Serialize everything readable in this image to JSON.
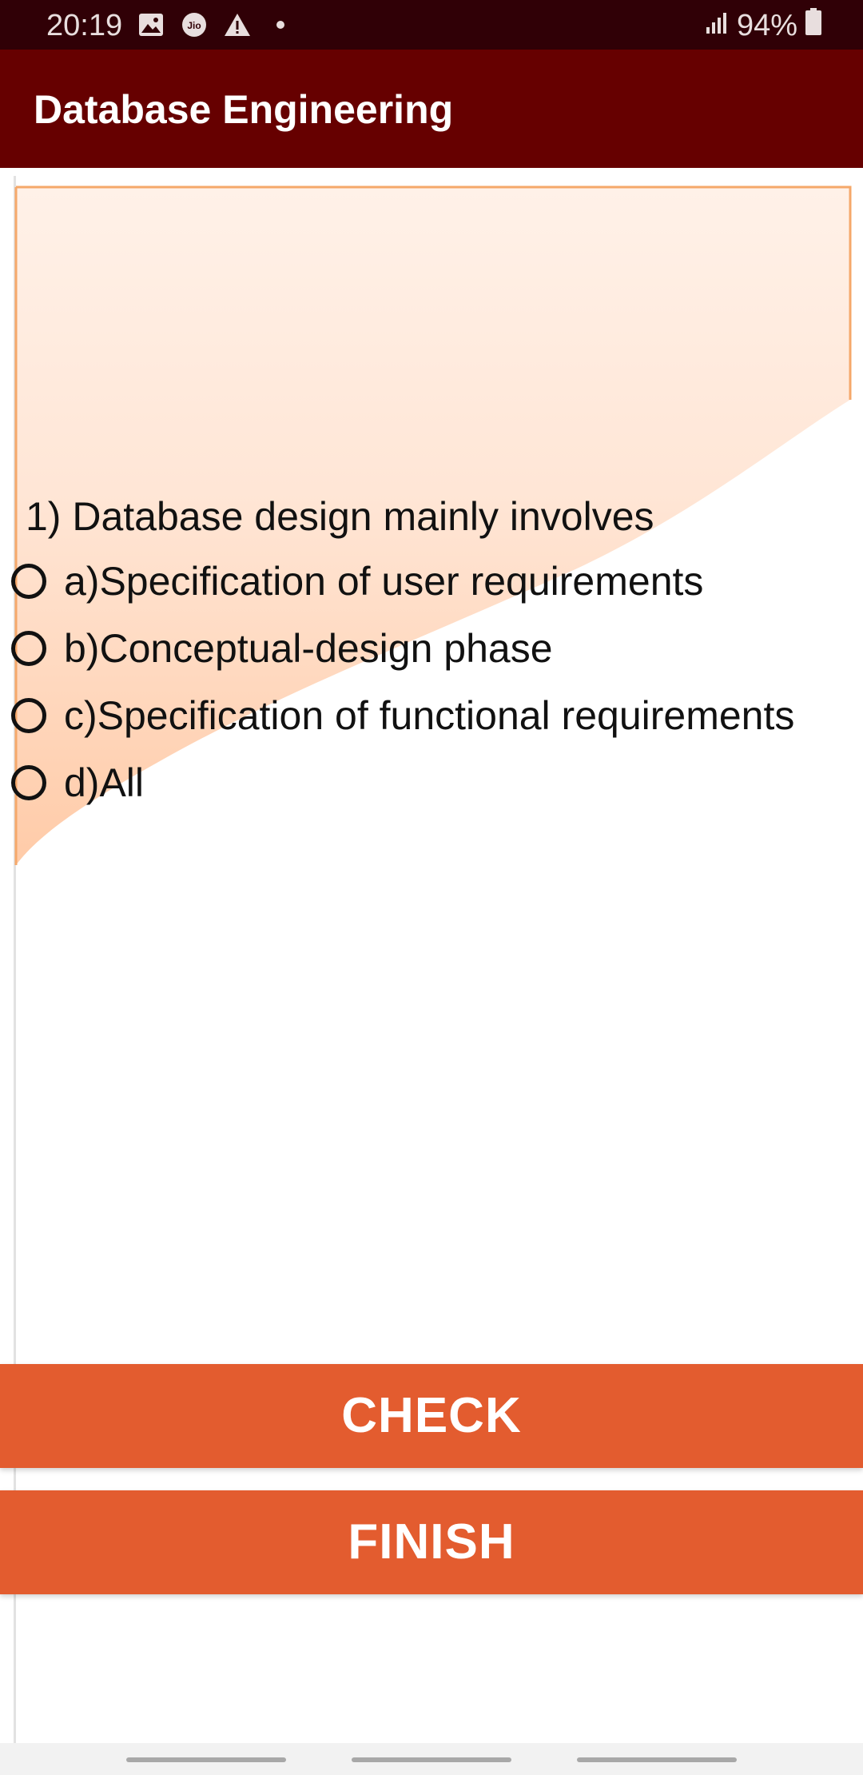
{
  "status_bar": {
    "time": "20:19",
    "battery": "94%",
    "icons": [
      "image-icon",
      "jio-icon",
      "alert-icon",
      "dot-icon",
      "signal-icon",
      "battery-icon"
    ],
    "jio_text": "Jio"
  },
  "app_bar": {
    "title": "Database Engineering",
    "color": "#660000"
  },
  "question": {
    "text": "1) Database design mainly involves",
    "options": [
      {
        "label": "a)Specification of user requirements",
        "selected": false
      },
      {
        "label": "b)Conceptual-design phase",
        "selected": false
      },
      {
        "label": "c)Specification of functional requirements",
        "selected": false
      },
      {
        "label": "d)All",
        "selected": false
      }
    ]
  },
  "buttons": {
    "check_label": "CHECK",
    "finish_label": "FINISH",
    "color": "#e35c2f"
  }
}
